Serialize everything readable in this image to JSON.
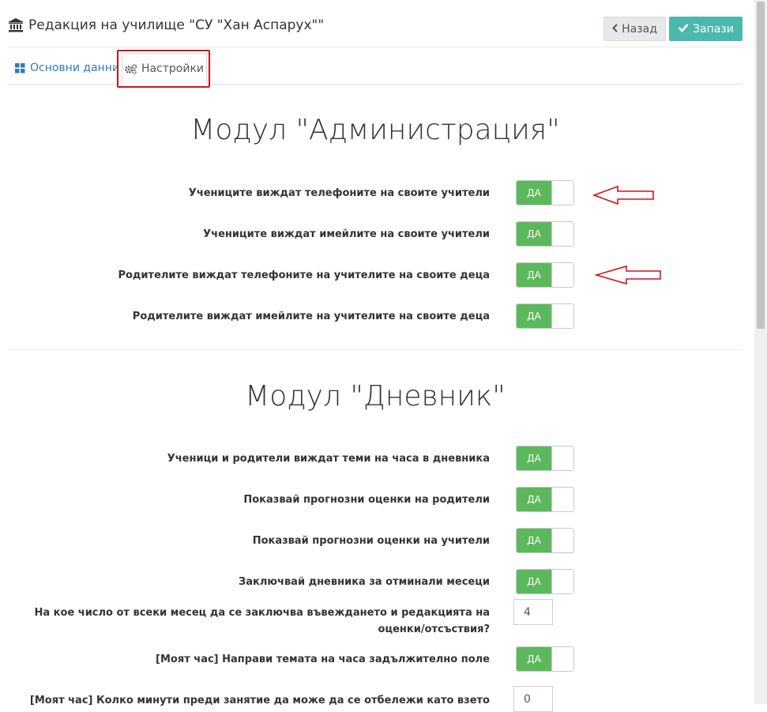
{
  "header": {
    "title": "Редакция на училище \"СУ \"Хан Аспарух\"\""
  },
  "buttons": {
    "back": "Назад",
    "save": "Запази"
  },
  "tabs": [
    {
      "label": "Основни данни",
      "active": false
    },
    {
      "label": "Настройки",
      "active": true
    }
  ],
  "modules": {
    "administration": {
      "title": "Модул \"Администрация\"",
      "settings": [
        {
          "label": "Учениците виждат телефоните на своите учители",
          "value": "ДА"
        },
        {
          "label": "Учениците виждат имейлите на своите учители",
          "value": "ДА"
        },
        {
          "label": "Родителите виждат телефоните на учителите на своите деца",
          "value": "ДА"
        },
        {
          "label": "Родителите виждат имейлите на учителите на своите деца",
          "value": "ДА"
        }
      ]
    },
    "diary": {
      "title": "Модул \"Дневник\"",
      "settings": [
        {
          "label": "Ученици и родители виждат теми на часа в дневника",
          "value": "ДА"
        },
        {
          "label": "Показвай прогнозни оценки на родители",
          "value": "ДА"
        },
        {
          "label": "Показвай прогнозни оценки на учители",
          "value": "ДА"
        },
        {
          "label": "Заключвай дневника за отминали месеци",
          "value": "ДА"
        },
        {
          "label": "На кое число от всеки месец да се заключва въвеждането и редакцията на оценки/отсъствия?",
          "value": "4"
        },
        {
          "label": "[Моят час] Направи темата на часа задължително поле",
          "value": "ДА"
        },
        {
          "label": "[Моят час] Колко минути преди занятие да може да се отбележи като взето",
          "value": "0"
        }
      ]
    }
  },
  "colors": {
    "toggle_on": "#5cb85c",
    "save_button": "#4cb8ad",
    "highlight": "#d0121b",
    "link": "#337ab7"
  }
}
